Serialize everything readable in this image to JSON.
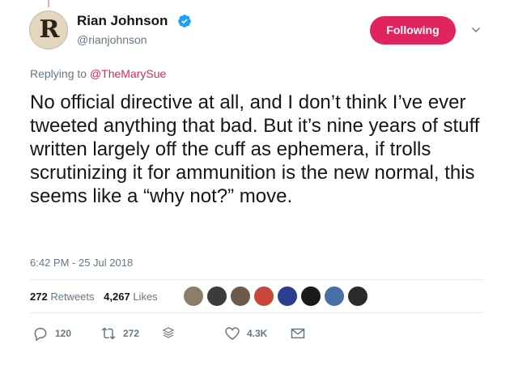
{
  "author": {
    "name": "Rian Johnson",
    "handle": "@rianjohnson",
    "avatar_letter": "R",
    "verified_icon": "verified-badge-icon"
  },
  "follow_button": {
    "label": "Following",
    "color": "#e0245e"
  },
  "menu": {
    "icon": "chevron-down-icon"
  },
  "reply": {
    "prefix": "Replying to",
    "target": "@TheMarySue"
  },
  "tweet": {
    "text": "No official directive at all, and I don’t think I’ve ever tweeted anything that bad. But it’s nine years of stuff written largely off the cuff as ephemera, if trolls scrutinizing it for ammunition is the new normal, this seems like a “why not?” move.",
    "timestamp": "6:42 PM - 25 Jul 2018"
  },
  "stats": {
    "retweets_count": "272",
    "retweets_label": "Retweets",
    "likes_count": "4,267",
    "likes_label": "Likes"
  },
  "likers": {
    "colors": [
      "#8a7f66",
      "#3b3b3b",
      "#6d5a4a",
      "#c8473a",
      "#2a3f8f",
      "#1a1a1a",
      "#4a6fa5",
      "#2b2b2b"
    ]
  },
  "actions": {
    "reply_count": "120",
    "retweet_count": "272",
    "like_count": "4.3K"
  },
  "colors": {
    "text": "#14171a",
    "secondary": "#657786",
    "accent": "#e0245e",
    "verified": "#1da1f2",
    "border": "#e6ecf0"
  }
}
